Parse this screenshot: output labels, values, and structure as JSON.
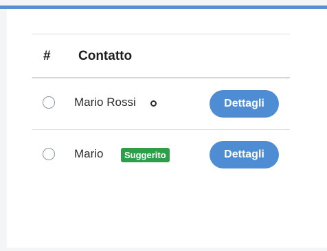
{
  "table": {
    "headers": {
      "number": "#",
      "contact": "Contatto"
    },
    "rows": [
      {
        "name": "Mario Rossi",
        "status_icon": "circle-outline-icon",
        "button_label": "Dettagli"
      },
      {
        "name": "Mario",
        "badge": "Suggerito",
        "button_label": "Dettagli"
      }
    ]
  },
  "colors": {
    "accent": "#5a8fd3",
    "button": "#4e8dd3",
    "badge": "#2f9e48"
  }
}
